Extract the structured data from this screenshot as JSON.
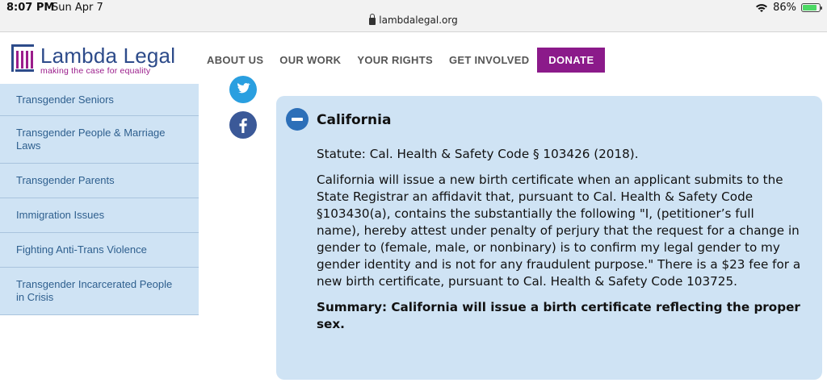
{
  "status_bar": {
    "time": "8:07 PM",
    "date": "Sun Apr 7",
    "battery": "86%",
    "battery_level": 0.86,
    "url": "lambdalegal.org"
  },
  "header": {
    "logo_name": "Lambda Legal",
    "logo_tagline": "making the case for equality",
    "brand_color": "#8b1a8a",
    "nav": [
      "ABOUT US",
      "OUR WORK",
      "YOUR RIGHTS",
      "GET INVOLVED"
    ],
    "donate_label": "DONATE"
  },
  "sidebar": {
    "items": [
      {
        "label": "Transgender Seniors"
      },
      {
        "label": "Transgender People & Marriage Laws"
      },
      {
        "label": "Transgender Parents"
      },
      {
        "label": "Immigration Issues"
      },
      {
        "label": "Fighting Anti-Trans Violence"
      },
      {
        "label": "Transgender Incarcerated People in Crisis"
      }
    ]
  },
  "social": {
    "icons": [
      "twitter-icon",
      "facebook-icon"
    ]
  },
  "accordion": {
    "title": "California",
    "statute": "Statute: Cal. Health & Safety Code § 103426 (2018).",
    "body": "California will issue a new birth certificate when an applicant submits to the State Registrar an affidavit that, pursuant to Cal. Health & Safety Code §103430(a), contains the substantially the following \"I, (petitioner’s full name), hereby attest under penalty of perjury that the request for a change in gender to (female, male, or nonbinary) is to confirm my legal gender to my gender identity and is not for any fraudulent purpose.\" There is a $23 fee for a new birth certificate, pursuant to Cal. Health & Safety Code 103725.",
    "summary": "Summary: California will issue a birth certificate reflecting the proper sex."
  }
}
